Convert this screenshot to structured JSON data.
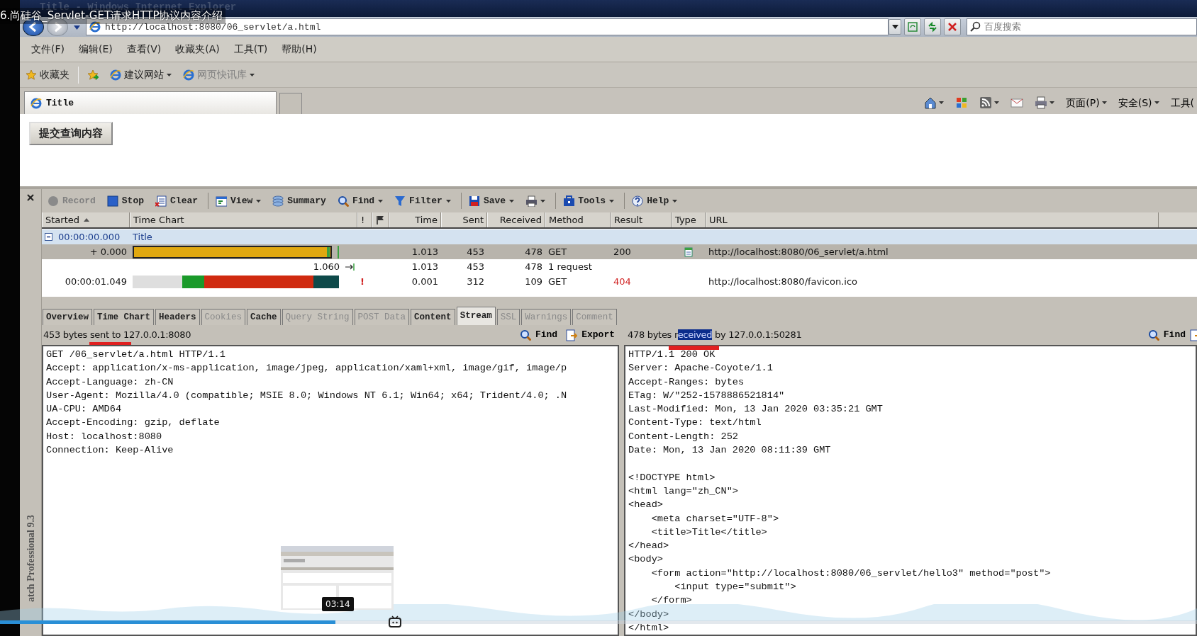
{
  "video": {
    "title": "6.尚硅谷_Servlet-GET请求HTTP协议内容介绍",
    "time": "03:14",
    "level": 0.28
  },
  "window": {
    "title": "Title - Windows Internet Explorer"
  },
  "address_bar": {
    "url": "http://localhost:8080/06_servlet/a.html",
    "placeholder": "百度搜索"
  },
  "menu": [
    "文件(F)",
    "编辑(E)",
    "查看(V)",
    "收藏夹(A)",
    "工具(T)",
    "帮助(H)"
  ],
  "favorites_bar": [
    {
      "label": "收藏夹",
      "dropdown": false,
      "disabled": false
    },
    {
      "label": "建议网站",
      "dropdown": true,
      "disabled": false
    },
    {
      "label": "网页快讯库",
      "dropdown": true,
      "disabled": true
    }
  ],
  "tabs": [
    {
      "label": "Title",
      "selected": true
    }
  ],
  "command_bar": [
    {
      "label": "页面(P)",
      "dropdown": true
    },
    {
      "label": "安全(S)",
      "dropdown": true
    },
    {
      "label": "工具(",
      "dropdown": false
    }
  ],
  "page": {
    "submit_button": "提交查询内容"
  },
  "httpwatch": {
    "sidebar_label": "atch Professional 9.3",
    "toolbar": [
      {
        "label": "Record",
        "disabled": true,
        "dropdown": false,
        "separator_before": false
      },
      {
        "label": "Stop",
        "disabled": false,
        "dropdown": false,
        "separator_before": false
      },
      {
        "label": "Clear",
        "disabled": false,
        "dropdown": false,
        "separator_before": false
      },
      {
        "label": "View",
        "disabled": false,
        "dropdown": true,
        "separator_before": true
      },
      {
        "label": "Summary",
        "disabled": false,
        "dropdown": false,
        "separator_before": false
      },
      {
        "label": "Find",
        "disabled": false,
        "dropdown": true,
        "separator_before": false
      },
      {
        "label": "Filter",
        "disabled": false,
        "dropdown": true,
        "separator_before": false
      },
      {
        "label": "Save",
        "disabled": false,
        "dropdown": true,
        "separator_before": true
      },
      {
        "kind": "icon",
        "disabled": false,
        "dropdown": true,
        "separator_before": false
      },
      {
        "label": "Tools",
        "disabled": false,
        "dropdown": true,
        "separator_before": true
      },
      {
        "label": "Help",
        "disabled": false,
        "dropdown": true,
        "separator_before": true
      }
    ],
    "columns": [
      {
        "label": "Started",
        "sorted": true
      },
      {
        "label": "Time Chart",
        "sorted": false
      },
      {
        "label": "!",
        "sorted": false
      },
      {
        "kind": "flag",
        "sorted": false
      },
      {
        "label": "Time",
        "sorted": false
      },
      {
        "label": "Sent",
        "sorted": false
      },
      {
        "label": "Received",
        "sorted": false
      },
      {
        "label": "Method",
        "sorted": false
      },
      {
        "label": "Result",
        "sorted": false
      },
      {
        "label": "Type",
        "sorted": false
      },
      {
        "label": "URL",
        "sorted": false
      }
    ],
    "rows": [
      {
        "kind": "group",
        "expanded": true,
        "started": "00:00:00.000",
        "title": "Title"
      },
      {
        "kind": "request",
        "selected": true,
        "failed": false,
        "started": "+ 0.000",
        "time": "1.013",
        "sent": "453",
        "received": "478",
        "method": "GET",
        "result": "200",
        "has_type_icon": true,
        "url": "http://localhost:8080/06_servlet/a.html"
      },
      {
        "kind": "summary",
        "selected": false,
        "chart_label": "1.060",
        "time": "1.013",
        "sent": "453",
        "received": "478",
        "method": "1 request"
      },
      {
        "kind": "request",
        "selected": false,
        "failed": true,
        "has_type_icon": false,
        "warning": "!",
        "started": "00:00:01.049",
        "time": "0.001",
        "sent": "312",
        "received": "109",
        "method": "GET",
        "result": "404",
        "url": "http://localhost:8080/favicon.ico"
      }
    ],
    "detail_tabs": [
      {
        "label": "Overview",
        "selected": false,
        "disabled": false
      },
      {
        "label": "Time Chart",
        "selected": false,
        "disabled": false
      },
      {
        "label": "Headers",
        "selected": false,
        "disabled": false
      },
      {
        "label": "Cookies",
        "selected": false,
        "disabled": true
      },
      {
        "label": "Cache",
        "selected": false,
        "disabled": false
      },
      {
        "label": "Query String",
        "selected": false,
        "disabled": true
      },
      {
        "label": "POST Data",
        "selected": false,
        "disabled": true
      },
      {
        "label": "Content",
        "selected": false,
        "disabled": false
      },
      {
        "label": "Stream",
        "selected": true,
        "disabled": false
      },
      {
        "label": "SSL",
        "selected": false,
        "disabled": true
      },
      {
        "label": "Warnings",
        "selected": false,
        "disabled": true
      },
      {
        "label": "Comment",
        "selected": false,
        "disabled": true
      }
    ],
    "request": {
      "summary": "453 bytes sent to 127.0.0.1:8080",
      "find": "Find",
      "export": "Export",
      "lines": [
        "GET /06_servlet/a.html HTTP/1.1",
        "Accept: application/x-ms-application, image/jpeg, application/xaml+xml, image/gif, image/p",
        "Accept-Language: zh-CN",
        "User-Agent: Mozilla/4.0 (compatible; MSIE 8.0; Windows NT 6.1; Win64; x64; Trident/4.0; .N",
        "UA-CPU: AMD64",
        "Accept-Encoding: gzip, deflate",
        "Host: localhost:8080",
        "Connection: Keep-Alive"
      ]
    },
    "response": {
      "summary_before": "478 bytes r",
      "summary_selected": "eceived",
      "summary_after": " by 127.0.0.1:50281",
      "find": "Find",
      "headers": [
        "HTTP/1.1 200 OK",
        "Server: Apache-Coyote/1.1",
        "Accept-Ranges: bytes",
        "ETag: W/\"252-1578886521814\"",
        "Last-Modified: Mon, 13 Jan 2020 03:35:21 GMT",
        "Content-Type: text/html",
        "Content-Length: 252",
        "Date: Mon, 13 Jan 2020 08:11:39 GMT"
      ],
      "body": [
        "<!DOCTYPE html>",
        "<html lang=\"zh_CN\">",
        "<head>",
        "    <meta charset=\"UTF-8\">",
        "    <title>Title</title>",
        "</head>",
        "<body>",
        "    <form action=\"http://localhost:8080/06_servlet/hello3\" method=\"post\">",
        "        <input type=\"submit\">",
        "    </form>",
        "</body>",
        "</html>"
      ]
    }
  }
}
